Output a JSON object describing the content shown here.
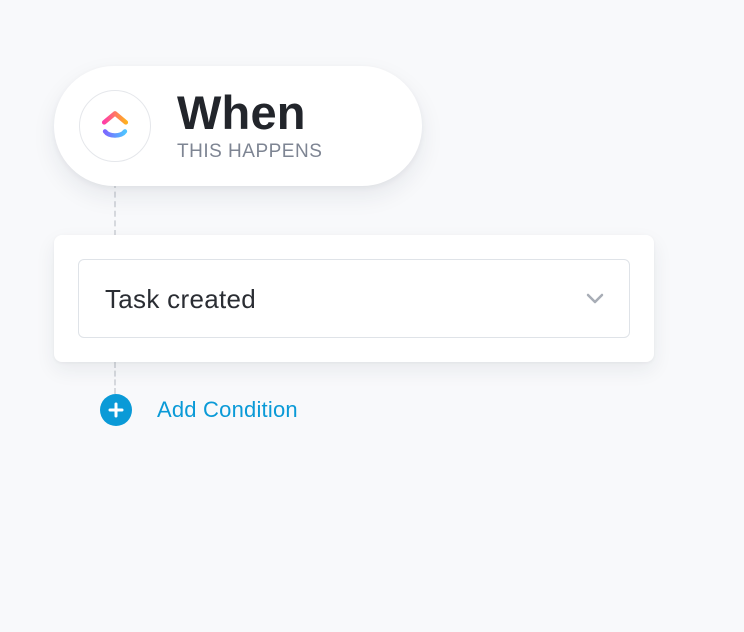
{
  "trigger": {
    "title": "When",
    "subtitle": "THIS HAPPENS",
    "logo_icon": "clickup-logo-icon"
  },
  "event_select": {
    "selected_value": "Task created",
    "icon": "chevron-down-icon"
  },
  "add_condition": {
    "label": "Add Condition",
    "icon": "plus-circle-icon"
  },
  "colors": {
    "background": "#f8f9fb",
    "accent": "#0a9ad7",
    "title_text": "#22252b",
    "subtitle_text": "#7e8593"
  }
}
